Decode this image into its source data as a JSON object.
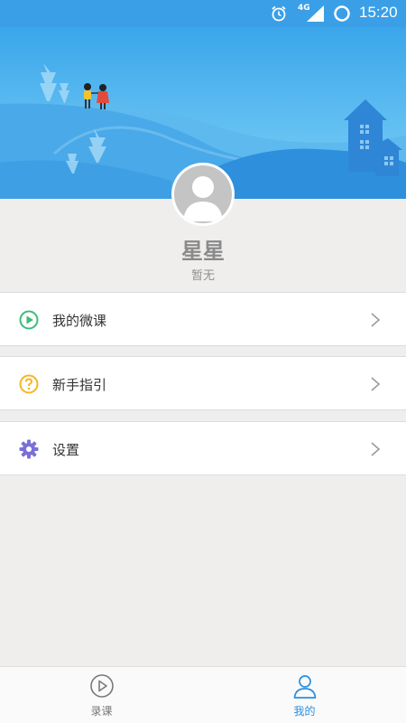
{
  "status_bar": {
    "network": "4G",
    "time": "15:20"
  },
  "profile": {
    "name": "星星",
    "subtitle": "暂无"
  },
  "menu": [
    {
      "label": "我的微课",
      "icon": "play-circle-icon",
      "color": "#3dbb7a"
    },
    {
      "label": "新手指引",
      "icon": "question-circle-icon",
      "color": "#f5b623"
    },
    {
      "label": "设置",
      "icon": "gear-icon",
      "color": "#7b6fd8"
    }
  ],
  "bottom_nav": [
    {
      "label": "录课",
      "icon": "play-circle-outline-icon",
      "active": false
    },
    {
      "label": "我的",
      "icon": "person-icon",
      "active": true
    }
  ],
  "colors": {
    "header_blue": "#3a9fe6",
    "active_tab": "#2a8fe0",
    "inactive_tab": "#777777"
  }
}
